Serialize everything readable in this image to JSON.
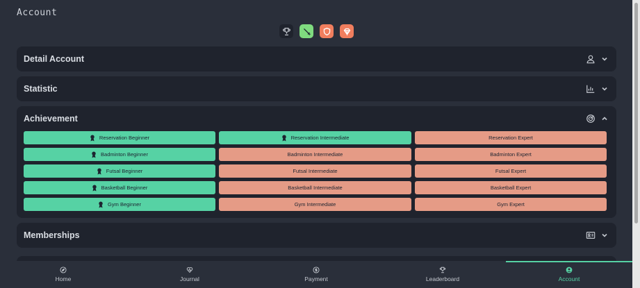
{
  "header": {
    "title": "Account"
  },
  "badges": [
    {
      "name": "trophy-badge",
      "icon": "trophy-icon",
      "bg": "#1f232d",
      "fg": "#c4c8cf"
    },
    {
      "name": "sword-badge",
      "icon": "sword-icon",
      "bg": "#7fdb7f",
      "fg": "#1d2430"
    },
    {
      "name": "shield-badge",
      "icon": "shield-icon",
      "bg": "#f07e5e",
      "fg": "#ffffff"
    },
    {
      "name": "gem-badge",
      "icon": "gem-icon",
      "bg": "#f07e5e",
      "fg": "#ffffff"
    }
  ],
  "panels": {
    "detail": {
      "title": "Detail Account",
      "icon": "user-icon",
      "expanded": false
    },
    "statistic": {
      "title": "Statistic",
      "icon": "bar-chart-icon",
      "expanded": false
    },
    "achievement": {
      "title": "Achievement",
      "icon": "target-icon",
      "expanded": true
    },
    "memberships": {
      "title": "Memberships",
      "icon": "id-card-icon",
      "expanded": false
    }
  },
  "achievements": [
    [
      {
        "label": "Reservation Beginner",
        "done": true
      },
      {
        "label": "Reservation Intermediate",
        "done": true
      },
      {
        "label": "Reservation Expert",
        "done": false
      }
    ],
    [
      {
        "label": "Badminton Beginner",
        "done": true
      },
      {
        "label": "Badminton Intermediate",
        "done": false
      },
      {
        "label": "Badminton Expert",
        "done": false
      }
    ],
    [
      {
        "label": "Futsal Beginner",
        "done": true
      },
      {
        "label": "Futsal Intermediate",
        "done": false
      },
      {
        "label": "Futsal Expert",
        "done": false
      }
    ],
    [
      {
        "label": "Basketball Beginner",
        "done": true
      },
      {
        "label": "Basketball Intermediate",
        "done": false
      },
      {
        "label": "Basketball Expert",
        "done": false
      }
    ],
    [
      {
        "label": "Gym Beginner",
        "done": true
      },
      {
        "label": "Gym Intermediate",
        "done": false
      },
      {
        "label": "Gym Expert",
        "done": false
      }
    ]
  ],
  "nav": [
    {
      "label": "Home",
      "icon": "compass-icon",
      "active": false
    },
    {
      "label": "Journal",
      "icon": "heart-icon",
      "active": false
    },
    {
      "label": "Payment",
      "icon": "coin-icon",
      "active": false
    },
    {
      "label": "Leaderboard",
      "icon": "trophy-icon",
      "active": false
    },
    {
      "label": "Account",
      "icon": "account-icon",
      "active": true
    }
  ],
  "colors": {
    "accent": "#56d2a4",
    "locked": "#e59b86",
    "panel": "#1f232d",
    "background": "#2a2f3a"
  }
}
